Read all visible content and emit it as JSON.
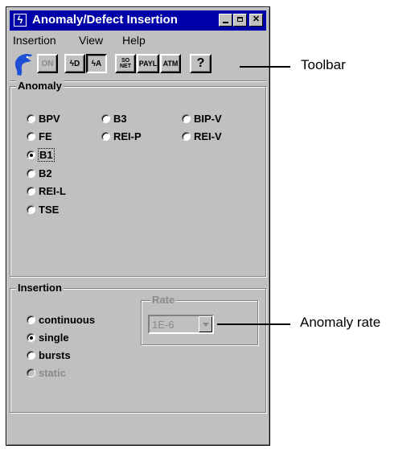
{
  "window": {
    "title": "Anomaly/Defect Insertion",
    "title_icon": "lightning-icon",
    "controls": [
      "minimize-icon",
      "maximize-icon",
      "close-icon"
    ],
    "titlebar_color": "#0000a8"
  },
  "menu": [
    "Insertion",
    "View",
    "Help"
  ],
  "toolbar": {
    "buttons": [
      {
        "label": "ON",
        "state": "disabled"
      },
      {
        "label": "ϟD",
        "state": "normal"
      },
      {
        "label": "ϟA",
        "state": "pressed"
      },
      {
        "label": "SO NET",
        "state": "normal"
      },
      {
        "label": "PAYL",
        "state": "normal"
      },
      {
        "label": "ATM",
        "state": "normal"
      },
      {
        "label": "?",
        "state": "normal"
      }
    ]
  },
  "anomaly": {
    "label": "Anomaly",
    "options": [
      "BPV",
      "B3",
      "BIP-V",
      "FE",
      "REI-P",
      "REI-V",
      "B1",
      "B2",
      "REI-L",
      "TSE"
    ],
    "selected": "B1"
  },
  "insertion": {
    "label": "Insertion",
    "options": [
      "continuous",
      "single",
      "bursts",
      "static"
    ],
    "selected": "single",
    "disabled": [
      "static"
    ]
  },
  "rate": {
    "label": "Rate",
    "value": "1E-6",
    "enabled": false
  },
  "callouts": {
    "toolbar": "Toolbar",
    "rate": "Anomaly rate"
  }
}
